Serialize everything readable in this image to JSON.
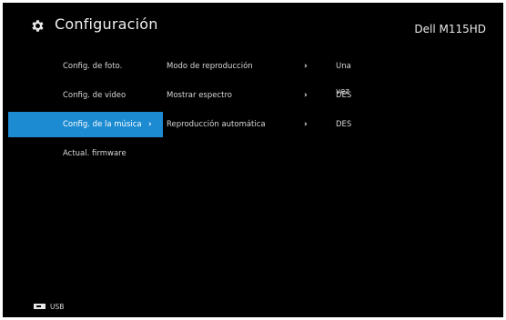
{
  "header": {
    "title": "Configuración",
    "icon": "gear-icon",
    "model": "Dell M115HD"
  },
  "categories": [
    {
      "label": "Config. de foto.",
      "active": false
    },
    {
      "label": "Config. de video",
      "active": false
    },
    {
      "label": "Config. de la música",
      "active": true
    },
    {
      "label": "Actual. firmware",
      "active": false
    }
  ],
  "options": [
    {
      "name": "Modo de reproducción",
      "value": "Una vez"
    },
    {
      "name": "Mostrar espectro",
      "value": "DES"
    },
    {
      "name": "Reproducción automática",
      "value": "DES"
    }
  ],
  "chevron": "›",
  "footer": {
    "source_icon": "usb-icon",
    "source_label": "USB"
  },
  "colors": {
    "background": "#000000",
    "highlight": "#1d8bd2",
    "text": "#e8e8e8"
  }
}
